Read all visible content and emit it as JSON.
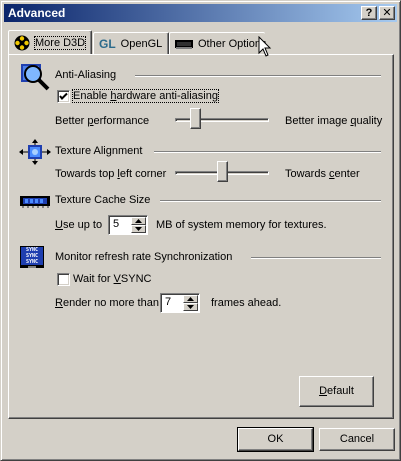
{
  "window": {
    "title": "Advanced",
    "help_glyph": "?",
    "close_glyph": "✕"
  },
  "tabs": [
    {
      "label": "More D3D",
      "icon": "d3d-badge-icon",
      "active": true
    },
    {
      "label": "OpenGL",
      "icon_text": "GL",
      "icon": "opengl-gl-icon",
      "active": false
    },
    {
      "label": "Other Options",
      "icon": "video-card-icon",
      "active": false
    }
  ],
  "antialiasing": {
    "title": "Anti-Aliasing",
    "checkbox_label": "Enable hardware anti-aliasing",
    "checked": true,
    "left_label": "Better performance",
    "right_label": "Better image quality",
    "slider_fraction": 0.18
  },
  "texture_alignment": {
    "title": "Texture Alignment",
    "left_label": "Towards top left corner",
    "right_label": "Towards center",
    "slider_fraction": 0.5
  },
  "texture_cache": {
    "title": "Texture Cache Size",
    "prefix": "Use up to",
    "value": "5",
    "suffix": "MB of system memory for textures."
  },
  "vsync": {
    "title": "Monitor refresh rate Synchronization",
    "icon_text": [
      "SYNC",
      "SYNC",
      "SYNC"
    ],
    "checkbox_label": "Wait for VSYNC",
    "checked": false,
    "render_prefix": "Render no more than",
    "render_value": "7",
    "render_suffix": "frames ahead."
  },
  "buttons": {
    "default": "Default",
    "ok": "OK",
    "cancel": "Cancel"
  },
  "colors": {
    "title_gradient_start": "#0a246a",
    "title_gradient_end": "#a6caf0",
    "face": "#d4d0c8"
  }
}
